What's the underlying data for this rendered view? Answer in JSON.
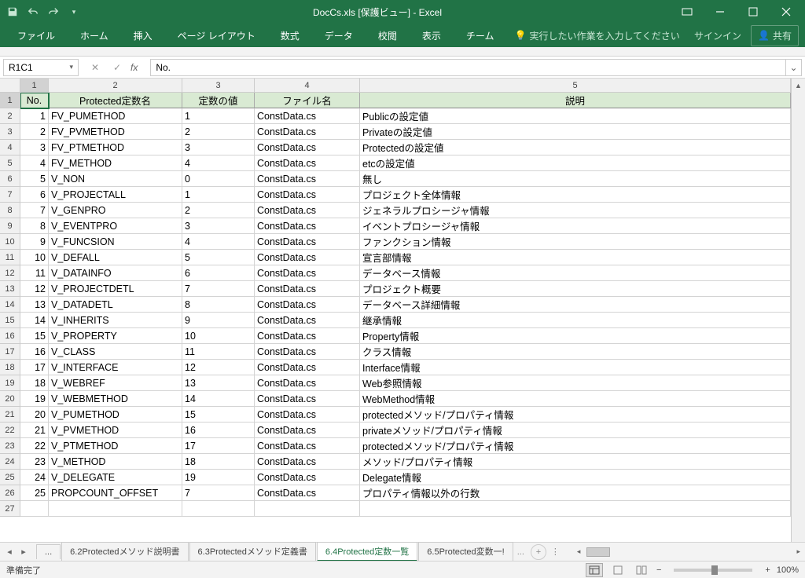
{
  "title": "DocCs.xls  [保護ビュー] - Excel",
  "qat": {
    "save": "save-icon",
    "undo": "undo-icon",
    "redo": "redo-icon",
    "customize": "customize-icon"
  },
  "ribbon": {
    "tabs": [
      "ファイル",
      "ホーム",
      "挿入",
      "ページ レイアウト",
      "数式",
      "データ",
      "校閲",
      "表示",
      "チーム"
    ],
    "tell": "実行したい作業を入力してください",
    "signin": "サインイン",
    "share": "共有"
  },
  "nameBox": "R1C1",
  "formula": "No.",
  "columns": [
    "1",
    "2",
    "3",
    "4",
    "5"
  ],
  "tableHeaders": [
    "No.",
    "Protected定数名",
    "定数の値",
    "ファイル名",
    "説明"
  ],
  "rows": [
    {
      "no": "1",
      "name": "FV_PUMETHOD",
      "val": "1",
      "file": "ConstData.cs",
      "desc": "Publicの設定値"
    },
    {
      "no": "2",
      "name": "FV_PVMETHOD",
      "val": "2",
      "file": "ConstData.cs",
      "desc": "Privateの設定値"
    },
    {
      "no": "3",
      "name": "FV_PTMETHOD",
      "val": "3",
      "file": "ConstData.cs",
      "desc": "Protectedの設定値"
    },
    {
      "no": "4",
      "name": "FV_METHOD",
      "val": "4",
      "file": "ConstData.cs",
      "desc": "etcの設定値"
    },
    {
      "no": "5",
      "name": "V_NON",
      "val": "0",
      "file": "ConstData.cs",
      "desc": "無し"
    },
    {
      "no": "6",
      "name": "V_PROJECTALL",
      "val": "1",
      "file": "ConstData.cs",
      "desc": "プロジェクト全体情報"
    },
    {
      "no": "7",
      "name": "V_GENPRO",
      "val": "2",
      "file": "ConstData.cs",
      "desc": "ジェネラルプロシージャ情報"
    },
    {
      "no": "8",
      "name": "V_EVENTPRO",
      "val": "3",
      "file": "ConstData.cs",
      "desc": "イベントプロシージャ情報"
    },
    {
      "no": "9",
      "name": "V_FUNCSION",
      "val": "4",
      "file": "ConstData.cs",
      "desc": "ファンクション情報"
    },
    {
      "no": "10",
      "name": "V_DEFALL",
      "val": "5",
      "file": "ConstData.cs",
      "desc": "宣言部情報"
    },
    {
      "no": "11",
      "name": "V_DATAINFO",
      "val": "6",
      "file": "ConstData.cs",
      "desc": "データベース情報"
    },
    {
      "no": "12",
      "name": "V_PROJECTDETL",
      "val": "7",
      "file": "ConstData.cs",
      "desc": "プロジェクト概要"
    },
    {
      "no": "13",
      "name": "V_DATADETL",
      "val": "8",
      "file": "ConstData.cs",
      "desc": "データベース詳細情報"
    },
    {
      "no": "14",
      "name": "V_INHERITS",
      "val": "9",
      "file": "ConstData.cs",
      "desc": "継承情報"
    },
    {
      "no": "15",
      "name": "V_PROPERTY",
      "val": "10",
      "file": "ConstData.cs",
      "desc": "Property情報"
    },
    {
      "no": "16",
      "name": "V_CLASS",
      "val": "11",
      "file": "ConstData.cs",
      "desc": "クラス情報"
    },
    {
      "no": "17",
      "name": "V_INTERFACE",
      "val": "12",
      "file": "ConstData.cs",
      "desc": "Interface情報"
    },
    {
      "no": "18",
      "name": "V_WEBREF",
      "val": "13",
      "file": "ConstData.cs",
      "desc": "Web参照情報"
    },
    {
      "no": "19",
      "name": "V_WEBMETHOD",
      "val": "14",
      "file": "ConstData.cs",
      "desc": "WebMethod情報"
    },
    {
      "no": "20",
      "name": "V_PUMETHOD",
      "val": "15",
      "file": "ConstData.cs",
      "desc": "protectedメソッド/プロパティ情報"
    },
    {
      "no": "21",
      "name": "V_PVMETHOD",
      "val": "16",
      "file": "ConstData.cs",
      "desc": "privateメソッド/プロパティ情報"
    },
    {
      "no": "22",
      "name": "V_PTMETHOD",
      "val": "17",
      "file": "ConstData.cs",
      "desc": "protectedメソッド/プロパティ情報"
    },
    {
      "no": "23",
      "name": "V_METHOD",
      "val": "18",
      "file": "ConstData.cs",
      "desc": "メソッド/プロパティ情報"
    },
    {
      "no": "24",
      "name": "V_DELEGATE",
      "val": "19",
      "file": "ConstData.cs",
      "desc": "Delegate情報"
    },
    {
      "no": "25",
      "name": "PROPCOUNT_OFFSET",
      "val": "7",
      "file": "ConstData.cs",
      "desc": "プロパティ情報以外の行数"
    }
  ],
  "sheets": {
    "overflow": "...",
    "tabs": [
      "6.2Protectedメソッド説明書",
      "6.3Protectedメソッド定義書",
      "6.4Protected定数一覧",
      "6.5Protected変数一!"
    ],
    "activeIndex": 2,
    "ellipsis": "..."
  },
  "status": {
    "ready": "準備完了",
    "zoom": "100%"
  }
}
